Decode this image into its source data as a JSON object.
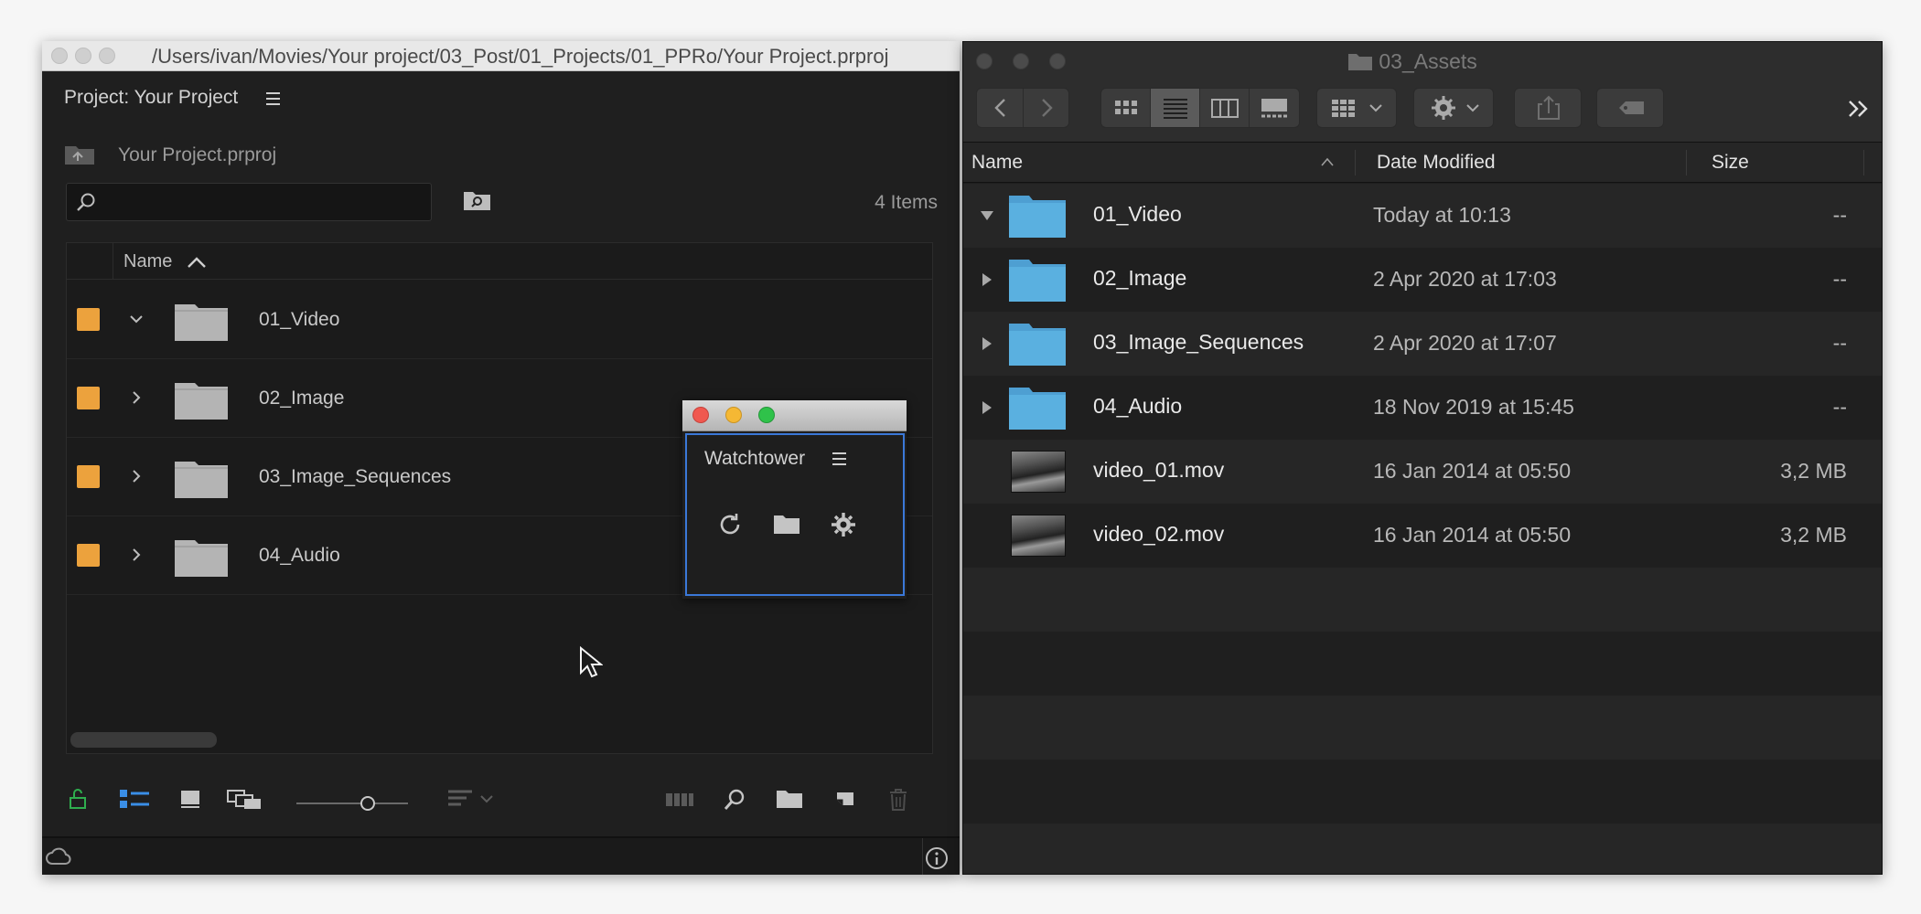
{
  "premiere": {
    "path": "/Users/ivan/Movies/Your project/03_Post/01_Projects/01_PPRo/Your Project.prproj",
    "panel_title": "Project: Your Project",
    "project_file": "Your Project.prproj",
    "search": {
      "value": "",
      "placeholder": ""
    },
    "item_count": "4 Items",
    "column_name": "Name",
    "items": [
      {
        "label": "01_Video",
        "expanded": true,
        "color": "#eca23d"
      },
      {
        "label": "02_Image",
        "expanded": false,
        "color": "#eca23d"
      },
      {
        "label": "03_Image_Sequences",
        "expanded": false,
        "color": "#eca23d"
      },
      {
        "label": "04_Audio",
        "expanded": false,
        "color": "#eca23d"
      }
    ]
  },
  "watchtower": {
    "title": "Watchtower"
  },
  "finder": {
    "title": "03_Assets",
    "columns": {
      "name": "Name",
      "date": "Date Modified",
      "size": "Size"
    },
    "rows": [
      {
        "name": "01_Video",
        "date": "Today at 10:13",
        "size": "--",
        "kind": "folder",
        "expanded": true
      },
      {
        "name": "02_Image",
        "date": "2 Apr 2020 at 17:03",
        "size": "--",
        "kind": "folder",
        "expanded": false
      },
      {
        "name": "03_Image_Sequences",
        "date": "2 Apr 2020 at 17:07",
        "size": "--",
        "kind": "folder",
        "expanded": false
      },
      {
        "name": "04_Audio",
        "date": "18 Nov 2019 at 15:45",
        "size": "--",
        "kind": "folder",
        "expanded": false
      },
      {
        "name": "video_01.mov",
        "date": "16 Jan 2014 at 05:50",
        "size": "3,2 MB",
        "kind": "file"
      },
      {
        "name": "video_02.mov",
        "date": "16 Jan 2014 at 05:50",
        "size": "3,2 MB",
        "kind": "file"
      }
    ]
  },
  "colors": {
    "label_orange": "#eca23d",
    "finder_folder": "#5ab0e0",
    "accent_blue": "#3a78d8",
    "lock_green": "#2fae4e"
  }
}
